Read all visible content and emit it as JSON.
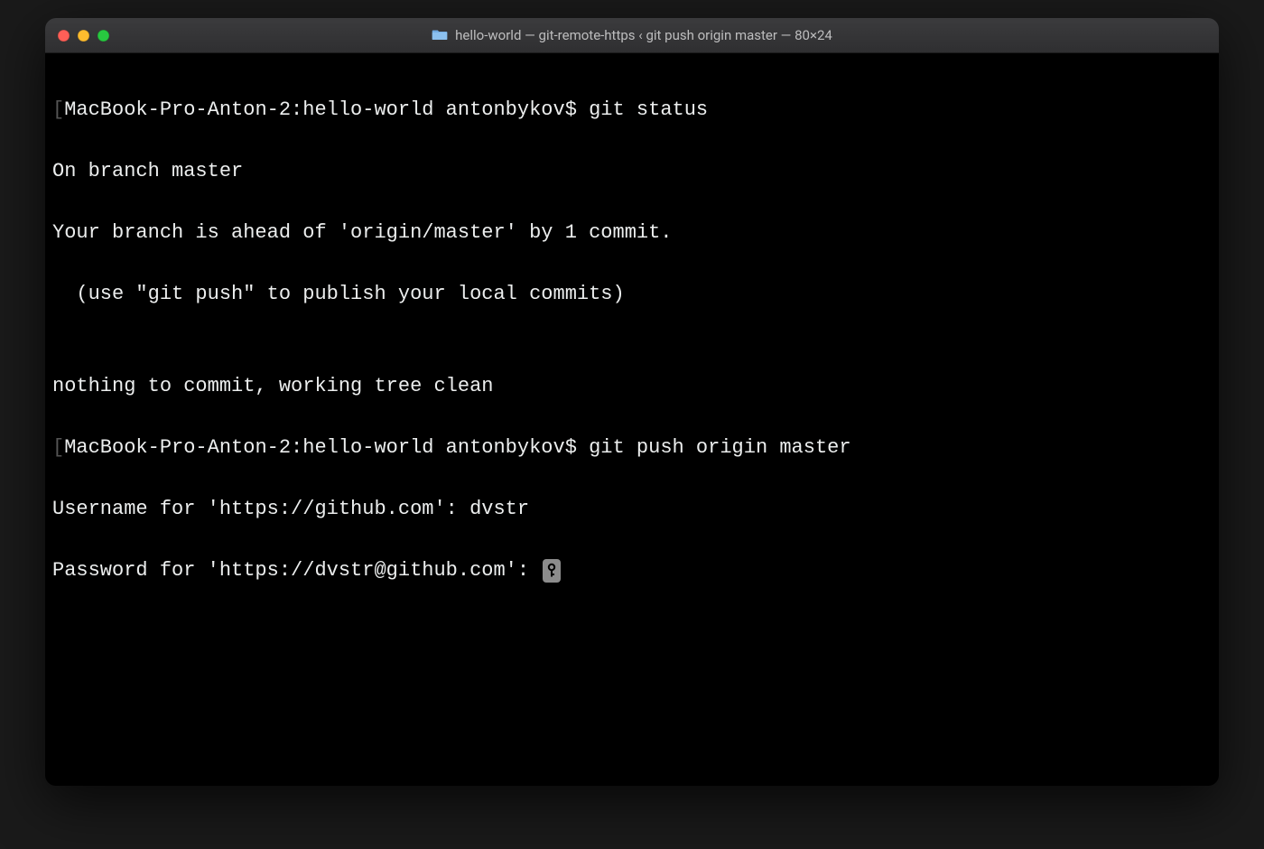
{
  "window": {
    "title": "hello-world — git-remote-https ‹ git push origin master — 80×24",
    "traffic": {
      "close": "close",
      "minimize": "minimize",
      "zoom": "zoom"
    },
    "folder_icon": "folder-icon"
  },
  "terminal": {
    "lines": {
      "l0_prompt": "MacBook-Pro-Anton-2:hello-world antonbykov$ ",
      "l0_cmd": "git status",
      "l1": "On branch master",
      "l2": "Your branch is ahead of 'origin/master' by 1 commit.",
      "l3": "  (use \"git push\" to publish your local commits)",
      "l4": "",
      "l5": "nothing to commit, working tree clean",
      "l6_prompt": "MacBook-Pro-Anton-2:hello-world antonbykov$ ",
      "l6_cmd": "git push origin master",
      "l7": "Username for 'https://github.com': dvstr",
      "l8": "Password for 'https://dvstr@github.com': "
    },
    "key_icon": "key-icon"
  }
}
